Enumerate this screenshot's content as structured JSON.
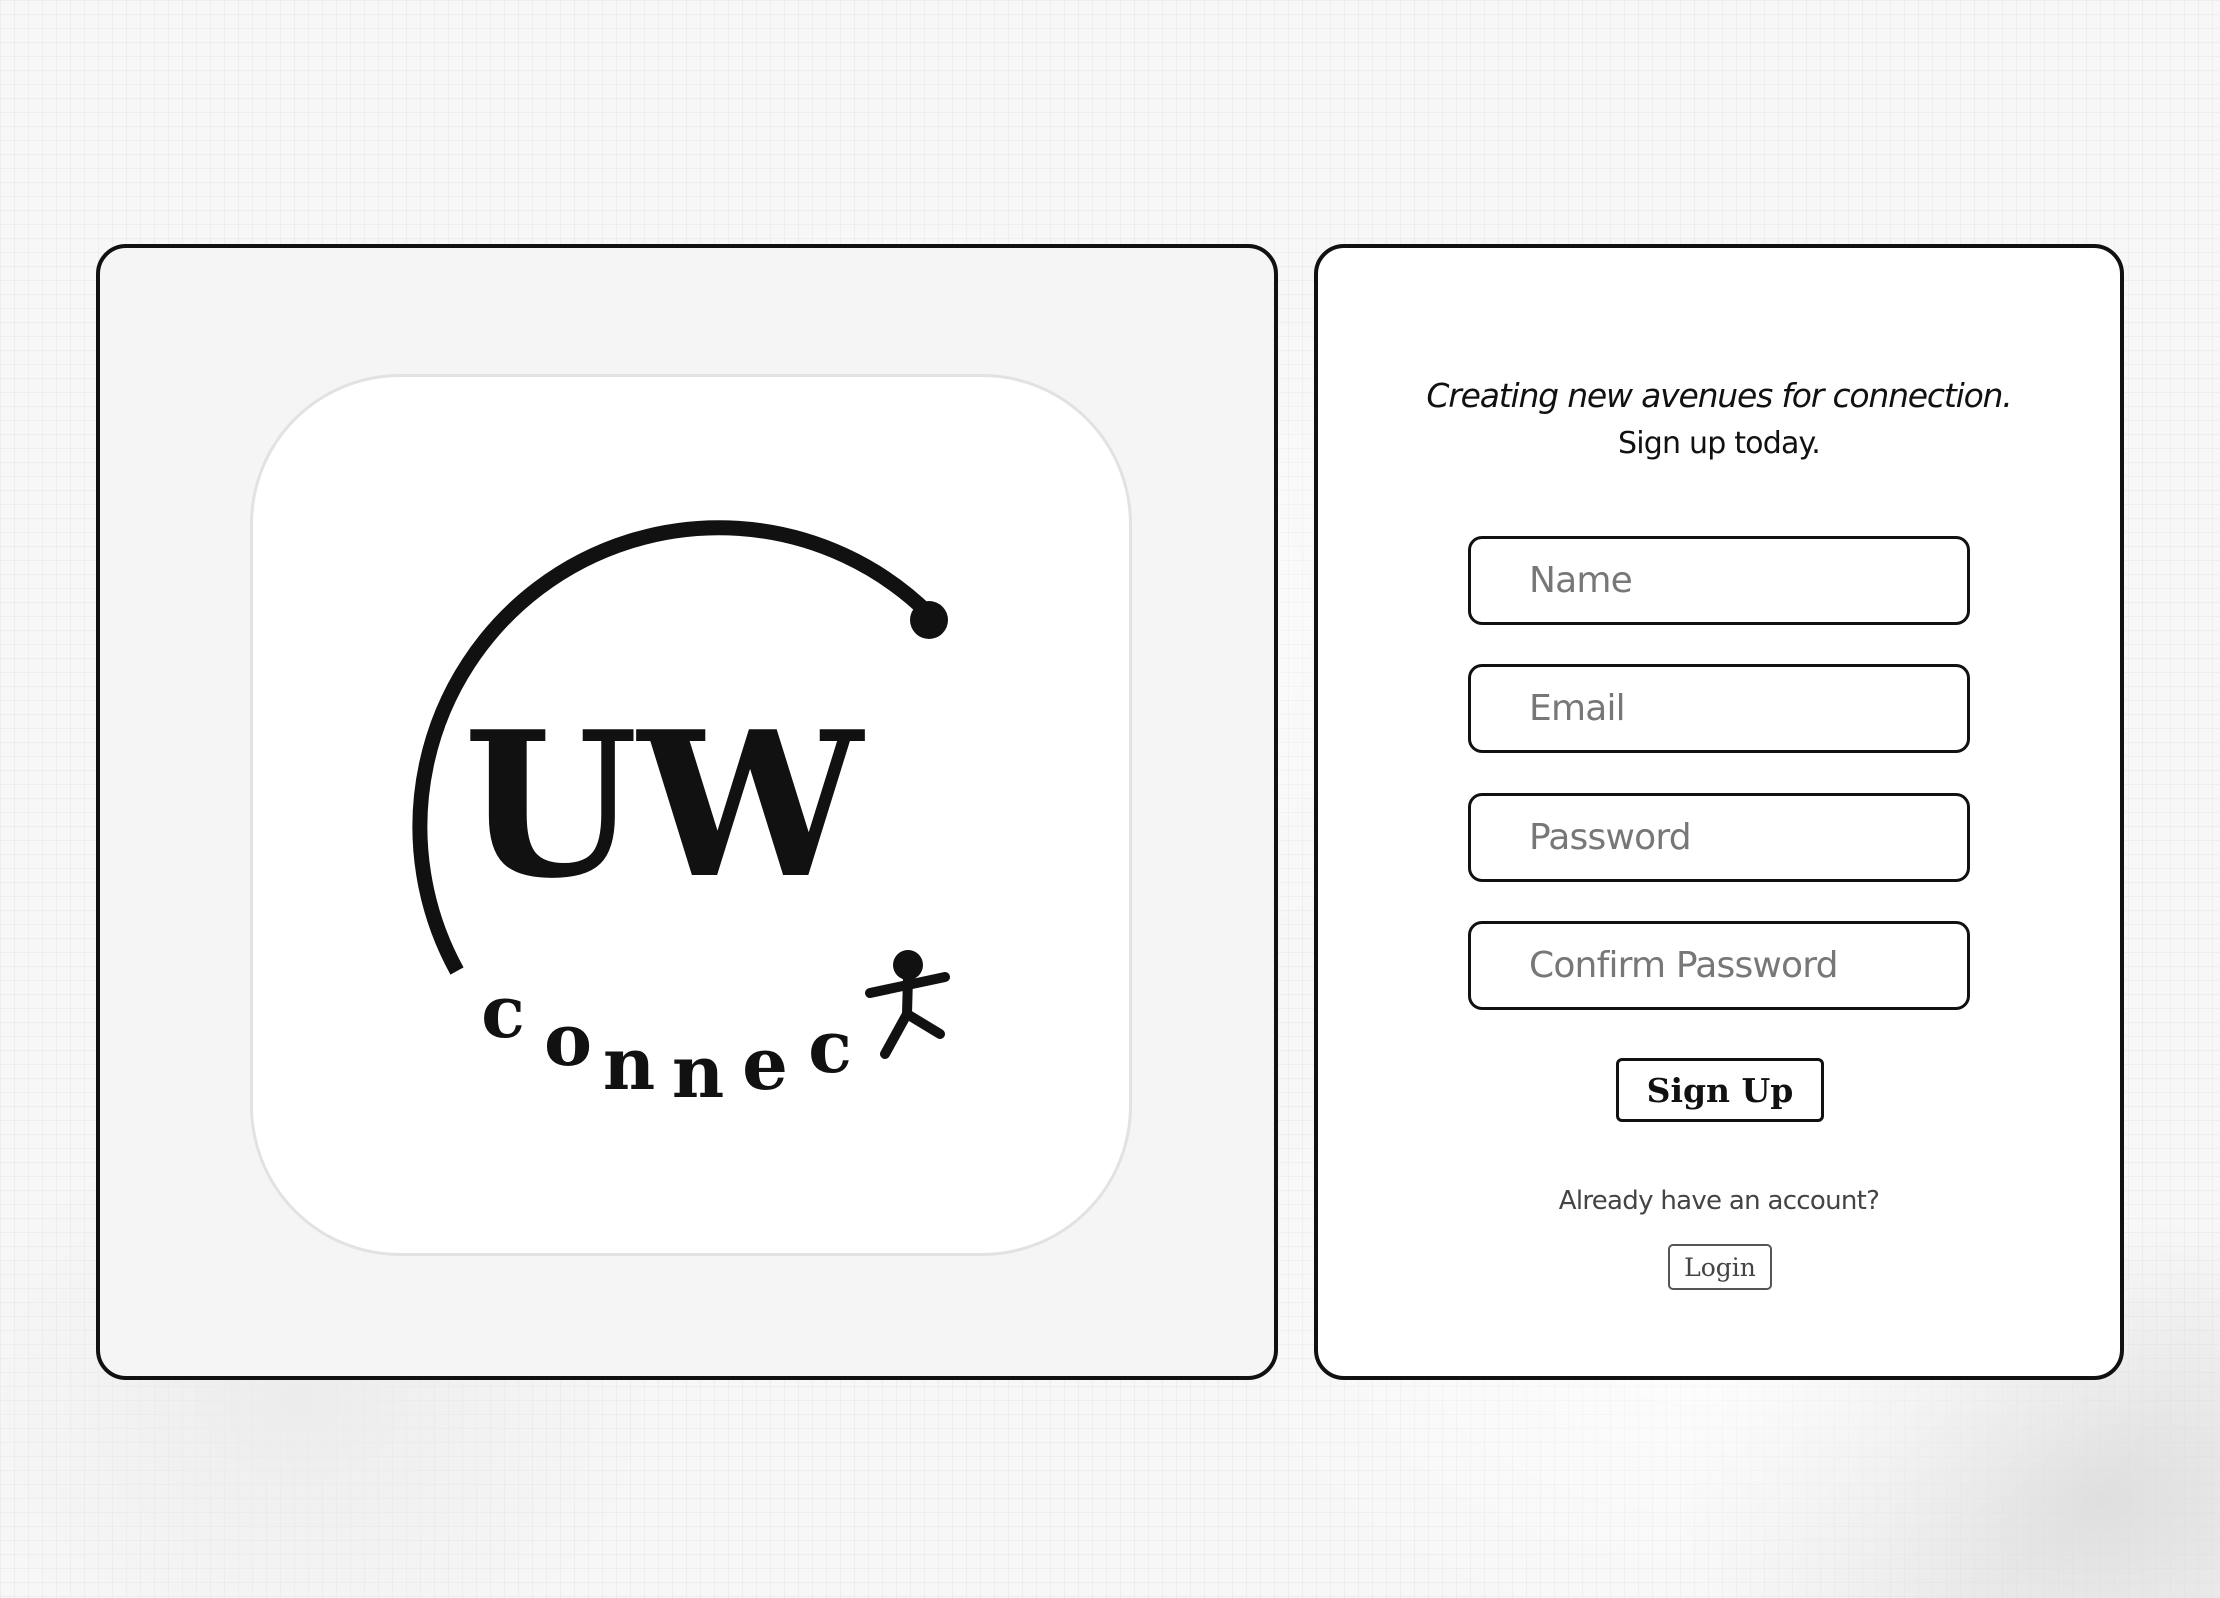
{
  "logo": {
    "title": "UW",
    "subtitle_letters": [
      "c",
      "o",
      "n",
      "n",
      "e",
      "c"
    ],
    "icon": "stick-figure-icon"
  },
  "signup": {
    "tagline": "Creating new avenues for connection.",
    "subline": "Sign up today.",
    "fields": {
      "name_placeholder": "Name",
      "email_placeholder": "Email",
      "password_placeholder": "Password",
      "confirm_placeholder": "Confirm Password"
    },
    "signup_label": "Sign Up",
    "account_prompt": "Already have an account?",
    "login_label": "Login"
  },
  "colors": {
    "ink": "#111111",
    "panel_bg": "#f5f5f5",
    "card_bg": "#ffffff",
    "placeholder": "#777777"
  }
}
